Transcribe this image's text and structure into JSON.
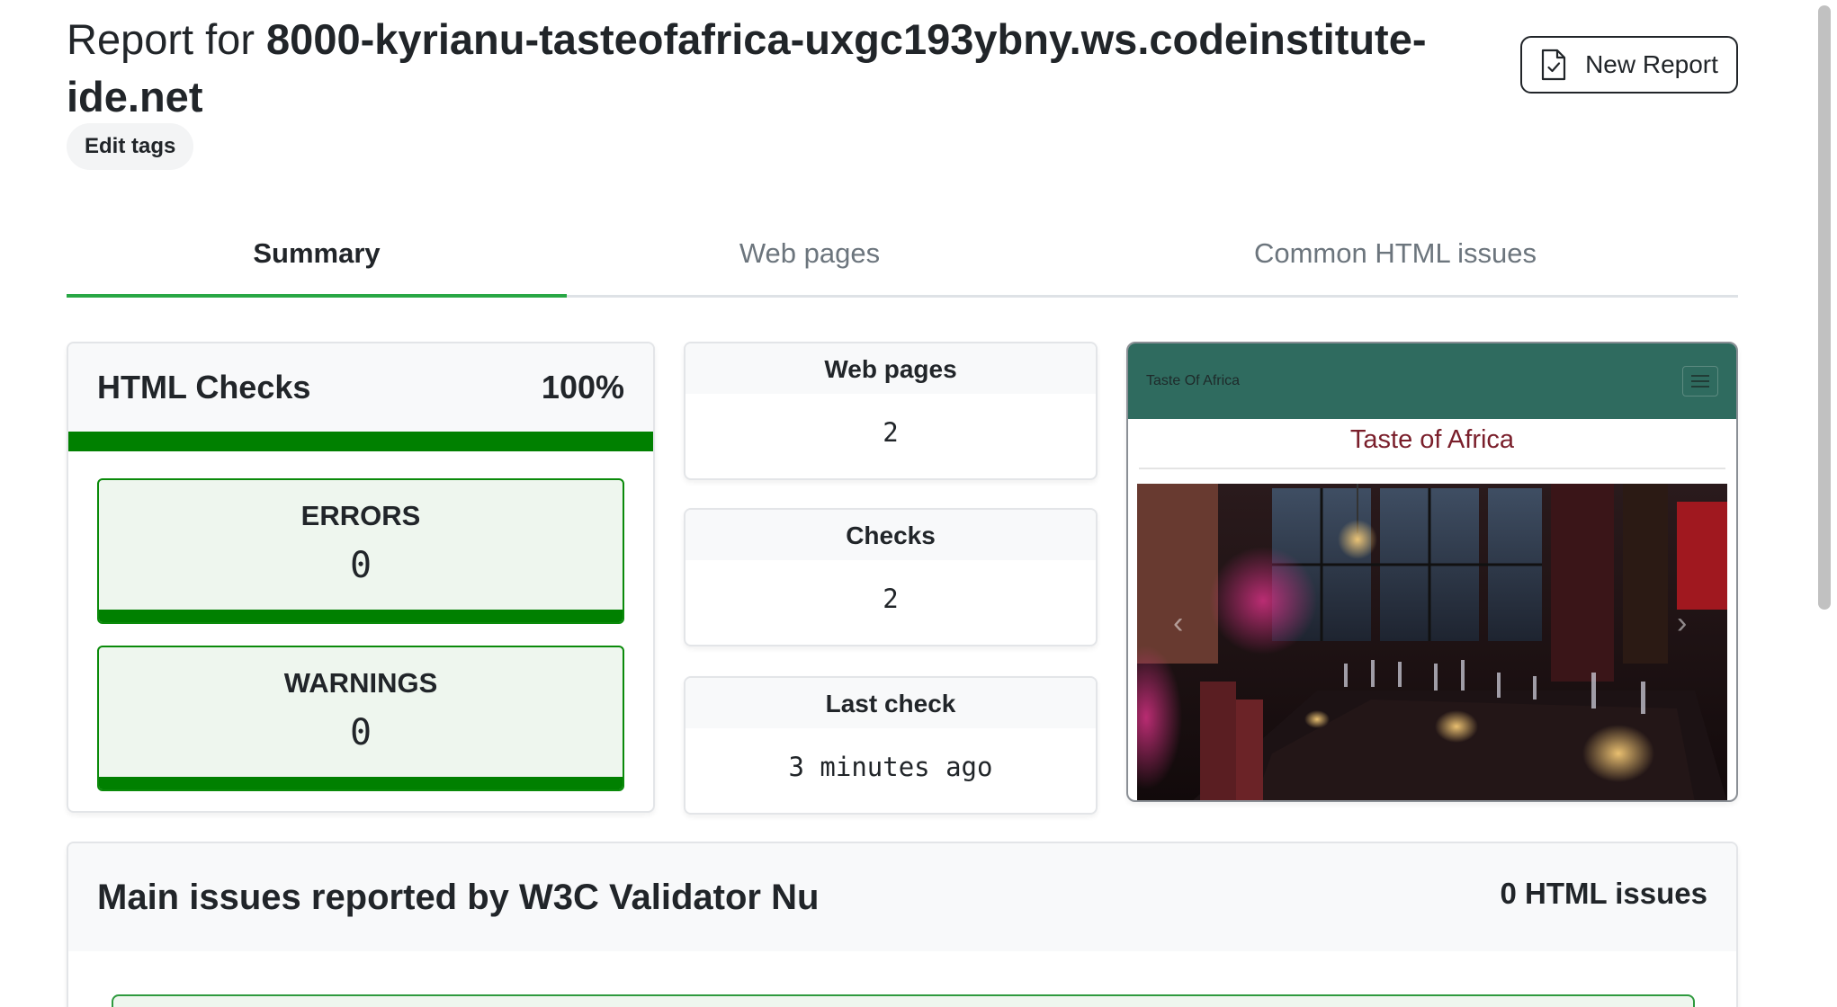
{
  "header": {
    "title_prefix": "Report for ",
    "title_site": "8000-kyrianu-tasteofafrica-uxgc193ybny.ws.codeinstitute-ide.net",
    "edit_tags_label": "Edit tags",
    "new_report_label": "New Report",
    "new_report_icon": "file-check-icon"
  },
  "tabs": [
    {
      "label": "Summary",
      "active": true
    },
    {
      "label": "Web pages",
      "active": false
    },
    {
      "label": "Common HTML issues",
      "active": false
    }
  ],
  "html_checks": {
    "title": "HTML Checks",
    "percent": "100%",
    "progress_fraction": 1.0,
    "errors_label": "ERRORS",
    "errors_value": "0",
    "warnings_label": "WARNINGS",
    "warnings_value": "0"
  },
  "stats": {
    "web_pages": {
      "label": "Web pages",
      "value": "2"
    },
    "checks": {
      "label": "Checks",
      "value": "2"
    },
    "last_check": {
      "label": "Last check",
      "value": "3 minutes ago"
    }
  },
  "preview": {
    "brand": "Taste Of Africa",
    "heading": "Taste of Africa",
    "menu_icon": "hamburger-menu-icon",
    "prev_icon": "chevron-left-icon",
    "next_icon": "chevron-right-icon"
  },
  "issues": {
    "title": "Main issues reported by W3C Validator Nu",
    "count_label": "0 HTML issues"
  },
  "colors": {
    "success_green": "#008000",
    "tab_active_underline": "#28a745",
    "preview_nav": "#2f6b5f",
    "preview_heading": "#7a1f2b"
  }
}
